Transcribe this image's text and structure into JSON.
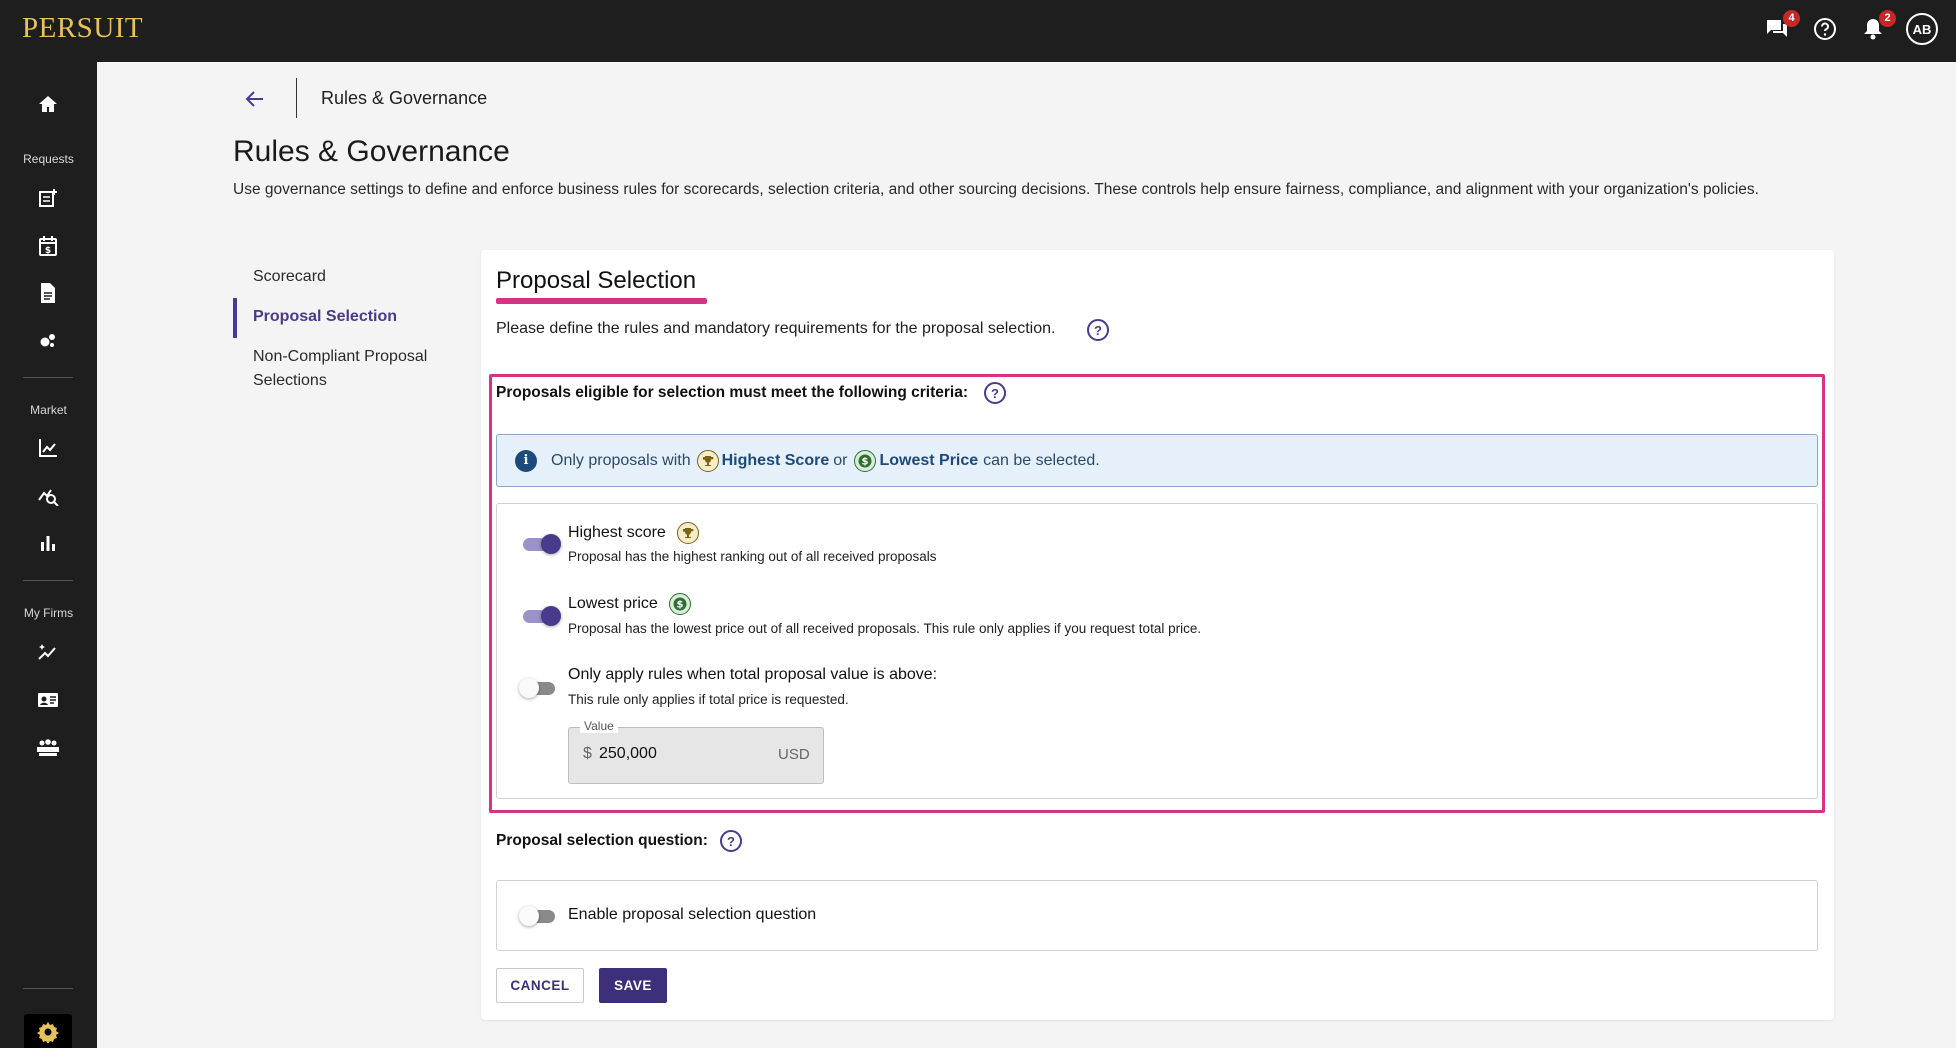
{
  "app": {
    "logo": "PERSUIT"
  },
  "topbar": {
    "messages_badge": "4",
    "notifications_badge": "2",
    "avatar_initials": "AB",
    "icons": [
      "chat-icon",
      "help-icon",
      "bell-icon",
      "avatar"
    ]
  },
  "sidebar": {
    "sections": {
      "requests": "Requests",
      "market": "Market",
      "my_firms": "My Firms"
    },
    "icons": [
      "home-icon",
      "new-request-icon",
      "calendar-pricing-icon",
      "document-icon",
      "bubbles-icon",
      "chart-line-icon",
      "insights-search-icon",
      "bar-chart-icon",
      "sparkle-chart-icon",
      "firm-card-icon",
      "team-icon",
      "settings-icon"
    ]
  },
  "header": {
    "breadcrumb": "Rules & Governance",
    "title": "Rules & Governance",
    "description": "Use governance settings to define and enforce business rules for scorecards, selection criteria, and other sourcing decisions. These controls help ensure fairness, compliance, and alignment with your organization's policies."
  },
  "leftnav": {
    "items": [
      {
        "label": "Scorecard",
        "active": false
      },
      {
        "label": "Proposal Selection",
        "active": true
      },
      {
        "label": "Non-Compliant Proposal Selections",
        "active": false
      }
    ]
  },
  "card": {
    "title": "Proposal Selection",
    "subtitle": "Please define the rules and mandatory requirements for the proposal selection.",
    "criteria_label": "Proposals eligible for selection must meet the following criteria:",
    "info": {
      "prefix": "Only proposals with",
      "highest": "Highest Score",
      "or": "or",
      "lowest": "Lowest Price",
      "suffix": "can be selected."
    },
    "rules": [
      {
        "title": "Highest score",
        "desc": "Proposal has the highest ranking out of all received proposals",
        "enabled": true
      },
      {
        "title": "Lowest price",
        "desc": "Proposal has the lowest price out of all received proposals. This rule only applies if you request total price.",
        "enabled": true
      },
      {
        "title": "Only apply rules when total proposal value is above:",
        "desc": "This rule only applies if total price is requested.",
        "enabled": false
      }
    ],
    "value_field": {
      "label": "Value",
      "currency_symbol": "$",
      "value": "250,000",
      "unit": "USD"
    },
    "question_label": "Proposal selection question:",
    "question_toggle": {
      "label": "Enable proposal selection question",
      "enabled": false
    },
    "buttons": {
      "cancel": "CANCEL",
      "save": "SAVE"
    }
  },
  "colors": {
    "accent": "#4a3a8c",
    "highlight": "#d63384",
    "brand_gold": "#e7c15a",
    "info_bg": "#e6f0fb"
  }
}
